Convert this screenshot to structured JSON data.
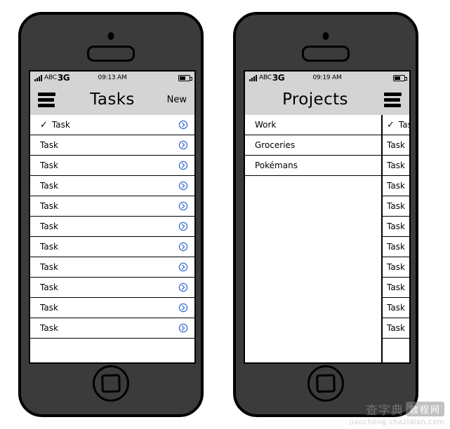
{
  "phones": [
    {
      "id": "phone-left",
      "status_bar": {
        "signal_icon": "signal-bars-icon",
        "carrier": "ABC",
        "network": "3G",
        "time": "09:13 AM",
        "battery_icon": "battery-icon"
      },
      "navbar": {
        "menu_icon": "hamburger-menu-icon",
        "title": "Tasks",
        "action_label": "New"
      },
      "list": {
        "rows": [
          {
            "label": "Task",
            "checked": true,
            "disclosure_icon": "chevron-right-circle-icon"
          },
          {
            "label": "Task",
            "checked": false,
            "disclosure_icon": "chevron-right-circle-icon"
          },
          {
            "label": "Task",
            "checked": false,
            "disclosure_icon": "chevron-right-circle-icon"
          },
          {
            "label": "Task",
            "checked": false,
            "disclosure_icon": "chevron-right-circle-icon"
          },
          {
            "label": "Task",
            "checked": false,
            "disclosure_icon": "chevron-right-circle-icon"
          },
          {
            "label": "Task",
            "checked": false,
            "disclosure_icon": "chevron-right-circle-icon"
          },
          {
            "label": "Task",
            "checked": false,
            "disclosure_icon": "chevron-right-circle-icon"
          },
          {
            "label": "Task",
            "checked": false,
            "disclosure_icon": "chevron-right-circle-icon"
          },
          {
            "label": "Task",
            "checked": false,
            "disclosure_icon": "chevron-right-circle-icon"
          },
          {
            "label": "Task",
            "checked": false,
            "disclosure_icon": "chevron-right-circle-icon"
          },
          {
            "label": "Task",
            "checked": false,
            "disclosure_icon": "chevron-right-circle-icon"
          }
        ]
      }
    },
    {
      "id": "phone-right",
      "status_bar": {
        "signal_icon": "signal-bars-icon",
        "carrier": "ABC",
        "network": "3G",
        "time": "09:19 AM",
        "battery_icon": "battery-icon"
      },
      "navbar": {
        "menu_icon": "hamburger-menu-icon",
        "title": "Projects"
      },
      "projects": {
        "rows": [
          {
            "label": "Work"
          },
          {
            "label": "Groceries"
          },
          {
            "label": "Pokémans"
          }
        ]
      },
      "tasks_peek": {
        "rows": [
          {
            "label": "Task",
            "checked": true
          },
          {
            "label": "Task",
            "checked": false
          },
          {
            "label": "Task",
            "checked": false
          },
          {
            "label": "Task",
            "checked": false
          },
          {
            "label": "Task",
            "checked": false
          },
          {
            "label": "Task",
            "checked": false
          },
          {
            "label": "Task",
            "checked": false
          },
          {
            "label": "Task",
            "checked": false
          },
          {
            "label": "Task",
            "checked": false
          },
          {
            "label": "Task",
            "checked": false
          },
          {
            "label": "Task",
            "checked": false
          }
        ]
      }
    }
  ],
  "hardware": {
    "camera_icon": "front-camera-icon",
    "speaker_icon": "earpiece-speaker-icon",
    "home_icon": "home-button-icon"
  },
  "glyphs": {
    "checkmark": "✓"
  },
  "colors": {
    "body": "#3b3b3b",
    "outline": "#000000",
    "chrome": "#d4d4d4",
    "screen": "#ffffff",
    "accent_blue": "#3b6fd4"
  },
  "watermark": {
    "cn_left": "查字典",
    "cn_box": "教程网",
    "url": "jiaocheng.chazidian.com"
  }
}
